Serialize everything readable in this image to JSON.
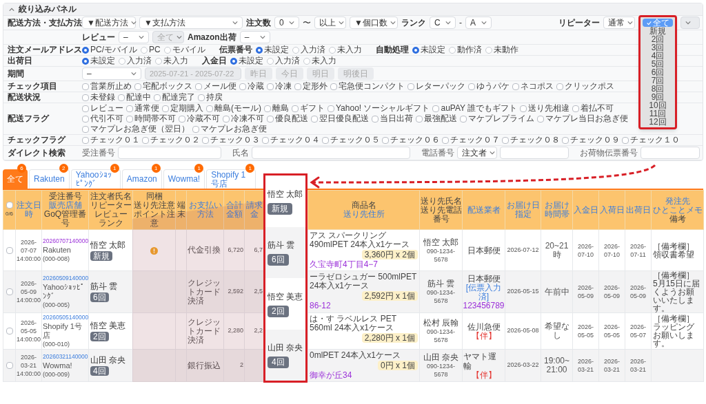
{
  "filter_panel": {
    "title": "絞り込みパネル",
    "expanded": true,
    "shipping_payment": {
      "label": "配送方法・支払方法",
      "shipping_method": "▼配送方法",
      "payment_method": "▼支払方法",
      "order_count_label": "注文数",
      "order_count_from": "0",
      "tilde": "〜",
      "order_count_to": "以上",
      "parcel_count": "▼個口数",
      "rank_label": "ランク",
      "rank_from": "C",
      "dash": "-",
      "rank_to": "A",
      "repeater_label": "リピーター",
      "repeater_mode": "通常",
      "repeater_options": [
        {
          "label": "全て",
          "selected": true
        },
        {
          "label": "新規",
          "selected": false
        },
        {
          "label": "2回",
          "selected": false
        },
        {
          "label": "3回",
          "selected": false
        },
        {
          "label": "4回",
          "selected": false
        },
        {
          "label": "5回",
          "selected": false
        },
        {
          "label": "6回",
          "selected": false
        },
        {
          "label": "7回",
          "selected": false
        },
        {
          "label": "8回",
          "selected": false
        },
        {
          "label": "9回",
          "selected": false
        },
        {
          "label": "10回",
          "selected": false
        },
        {
          "label": "11回",
          "selected": false
        },
        {
          "label": "12回",
          "selected": false
        }
      ],
      "repeater_count_disabled": true
    },
    "review_row": {
      "review_label": "レビュー",
      "review_value": "–",
      "review_scope": {
        "value": "全て",
        "disabled": true
      },
      "amazon_label": "Amazon出荷",
      "amazon_value": "–"
    },
    "radio_rows": [
      {
        "label": "注文メールアドレス",
        "groups": [
          {
            "options": [
              {
                "label": "PC/モバイル",
                "selected": true
              },
              {
                "label": "PC",
                "selected": false
              },
              {
                "label": "モバイル",
                "selected": false
              }
            ]
          },
          {
            "label": "伝票番号",
            "options": [
              {
                "label": "未設定",
                "selected": true
              },
              {
                "label": "入力済",
                "selected": false
              },
              {
                "label": "未入力",
                "selected": false
              }
            ]
          },
          {
            "label": "自動処理",
            "options": [
              {
                "label": "未設定",
                "selected": true
              },
              {
                "label": "動作済",
                "selected": false
              },
              {
                "label": "未動作",
                "selected": false
              }
            ]
          }
        ]
      },
      {
        "label": "出荷日",
        "groups": [
          {
            "options": [
              {
                "label": "未設定",
                "selected": true
              },
              {
                "label": "入力済",
                "selected": false
              },
              {
                "label": "未入力",
                "selected": false
              }
            ]
          },
          {
            "label": "入金日",
            "options": [
              {
                "label": "未設定",
                "selected": true
              },
              {
                "label": "入力済",
                "selected": false
              },
              {
                "label": "未入力",
                "selected": false
              }
            ]
          }
        ]
      }
    ],
    "period": {
      "label": "期間",
      "value": "–",
      "date_range": "2025-07-21 - 2025-07-22",
      "date_range_disabled": true,
      "quick_buttons": [
        {
          "label": "昨日",
          "disabled": true
        },
        {
          "label": "今日",
          "disabled": true
        },
        {
          "label": "明日",
          "disabled": true
        },
        {
          "label": "明後日",
          "disabled": true
        }
      ]
    },
    "check_rows": [
      {
        "label": "チェック項目",
        "items": [
          {
            "label": "営業所止め",
            "checked": false
          },
          {
            "label": "宅配ボックス",
            "checked": false
          },
          {
            "label": "メール便",
            "checked": false
          },
          {
            "label": "冷蔵",
            "checked": false
          },
          {
            "label": "冷凍",
            "checked": false
          },
          {
            "label": "定形外",
            "checked": false
          },
          {
            "label": "宅急便コンパクト",
            "checked": false
          },
          {
            "label": "レターパック",
            "checked": false
          },
          {
            "label": "ゆうパケ",
            "checked": false
          },
          {
            "label": "ネコポス",
            "checked": false
          },
          {
            "label": "クリックポス",
            "checked": false
          }
        ]
      },
      {
        "label": "配送状況",
        "items": [
          {
            "label": "未登録",
            "checked": false
          },
          {
            "label": "配達中",
            "checked": false
          },
          {
            "label": "配達完了",
            "checked": false
          },
          {
            "label": "持戻",
            "checked": false
          }
        ]
      },
      {
        "label": "配送フラグ",
        "items": [
          {
            "label": "レビュー",
            "checked": false
          },
          {
            "label": "通常便",
            "checked": false
          },
          {
            "label": "定期購入",
            "checked": false
          },
          {
            "label": "離島(モール)",
            "checked": false
          },
          {
            "label": "離島",
            "checked": false
          },
          {
            "label": "ギフト",
            "checked": false
          },
          {
            "label": "Yahoo! ソーシャルギフト",
            "checked": false
          },
          {
            "label": "auPAY 誰でもギフト",
            "checked": false
          },
          {
            "label": "送り先相違",
            "checked": false
          },
          {
            "label": "着払不可",
            "checked": false
          },
          {
            "label": "代引不可",
            "checked": false
          },
          {
            "label": "時間帯不可",
            "checked": false
          },
          {
            "label": "冷蔵不可",
            "checked": false
          },
          {
            "label": "冷凍不可",
            "checked": false
          },
          {
            "label": "優良配送",
            "checked": false
          },
          {
            "label": "翌日優良配送",
            "checked": false
          },
          {
            "label": "当日出荷",
            "checked": false
          },
          {
            "label": "最強配送",
            "checked": false
          },
          {
            "label": "マケプレプライム",
            "checked": false
          },
          {
            "label": "マケプレ当日お急ぎ便",
            "checked": false
          },
          {
            "label": "マケプレお急ぎ便（翌日）",
            "checked": false
          },
          {
            "label": "マケプレお急ぎ便",
            "checked": false
          }
        ]
      }
    ],
    "check_flags": {
      "label": "チェックフラグ",
      "items": [
        {
          "label": "チェック０１",
          "checked": false
        },
        {
          "label": "チェック０２",
          "checked": false
        },
        {
          "label": "チェック０３",
          "checked": false
        },
        {
          "label": "チェック０４",
          "checked": false
        },
        {
          "label": "チェック０５",
          "checked": false
        },
        {
          "label": "チェック０６",
          "checked": false
        },
        {
          "label": "チェック０７",
          "checked": false
        },
        {
          "label": "チェック０８",
          "checked": false
        },
        {
          "label": "チェック０９",
          "checked": false
        },
        {
          "label": "チェック１０",
          "checked": false
        }
      ]
    },
    "direct_search": {
      "label": "ダイレクト検索",
      "order_no_label": "受注番号",
      "name_label": "氏名",
      "phone_label": "電話番号",
      "phone_target": "注文者",
      "slip_label": "お荷物伝票番号"
    }
  },
  "order_tabs": [
    {
      "label": "全て",
      "count": "6",
      "selected": true
    },
    {
      "label": "Rakuten",
      "count": "2",
      "selected": false
    },
    {
      "label": "Yahooｼｮｯﾋﾟﾝｸﾞ",
      "count": "1",
      "selected": false
    },
    {
      "label": "Amazon",
      "count": "1",
      "selected": false
    },
    {
      "label": "Wowma!",
      "count": "1",
      "selected": false
    },
    {
      "label": "Shopify 1号店",
      "count": "1",
      "selected": false
    }
  ],
  "orders_table": {
    "select_all": {
      "checked": false
    },
    "selection_count": "0/6",
    "columns": [
      {
        "lines": [
          {
            "text": "注文日時",
            "link": true
          }
        ]
      },
      {
        "lines": [
          {
            "text": "受注番号",
            "link": false
          },
          {
            "text": "販売店舗",
            "link": true
          },
          {
            "text": "GoQ管理番号",
            "link": false
          }
        ]
      },
      {
        "lines": [
          {
            "text": "注文者氏名",
            "link": false
          },
          {
            "text": "リピーター",
            "link": false
          },
          {
            "text": "レビュー",
            "link": false
          },
          {
            "text": "ランク",
            "link": false
          }
        ]
      },
      {
        "lines": [
          {
            "text": "同梱",
            "link": false
          },
          {
            "text": "送り先注意",
            "link": false
          },
          {
            "text": "ポイント注意",
            "link": false
          }
        ]
      },
      {
        "lines": [
          {
            "text": "端末",
            "link": false
          }
        ]
      },
      {
        "lines": [
          {
            "text": "お支払い方法",
            "link": true
          }
        ]
      },
      {
        "lines": [
          {
            "text": "合計金額",
            "link": true
          }
        ]
      },
      {
        "lines": [
          {
            "text": "請求金",
            "link": true
          }
        ]
      },
      {
        "lines": [
          {
            "text": "商品名",
            "link": false
          },
          {
            "text": "送り先住所",
            "link": true
          }
        ]
      },
      {
        "lines": [
          {
            "text": "送り先氏名",
            "link": false
          },
          {
            "text": "送り先電話番号",
            "link": false
          }
        ]
      },
      {
        "lines": [
          {
            "text": "配送業者",
            "link": true
          }
        ]
      },
      {
        "lines": [
          {
            "text": "お届け日指定",
            "link": true
          }
        ]
      },
      {
        "lines": [
          {
            "text": "お届け時間帯",
            "link": true
          }
        ]
      },
      {
        "lines": [
          {
            "text": "入金日",
            "link": true
          }
        ]
      },
      {
        "lines": [
          {
            "text": "入荷日",
            "link": true
          }
        ]
      },
      {
        "lines": [
          {
            "text": "出荷日",
            "link": true
          }
        ]
      },
      {
        "lines": [
          {
            "text": "発注先",
            "link": true
          },
          {
            "text": "ひとことメモ",
            "link": true
          },
          {
            "text": "備考",
            "link": false
          }
        ]
      }
    ],
    "rows": [
      {
        "checked": false,
        "order_date": "2026-07-07 14:00:00",
        "order_no": "20260707140000",
        "visited": true,
        "store": "Rakuten",
        "goq_no": "(000-008)",
        "customer": "悟空 太郎",
        "repeater": "新規",
        "attention": true,
        "payment": "代金引換",
        "total": "6,720",
        "billed": "6,7",
        "product": "アス スパークリング 490mlPET 24本入x1ケース",
        "price": "3,360円 x 2個",
        "address": "久宝寺町4丁目4−7",
        "recipient": "悟空 太郎",
        "phone": "090-1234-5678",
        "carrier": "日本郵便",
        "delivery_date": "2026-07-12",
        "delivery_time": "20~21時",
        "paid": "2026-07-10",
        "arrived": "2026-07-10",
        "shipped": "2026-07-11",
        "memo_title": "［備考欄］",
        "memo": "領収書希望"
      },
      {
        "checked": false,
        "order_date": "2026-05-09 14:00:00",
        "order_no": "20260509140000",
        "visited": false,
        "store": "Yahooｼｮｯﾋﾟﾝｸﾞ",
        "goq_no": "(000-005)",
        "customer": "筋斗 雲",
        "repeater": "6回",
        "attention": false,
        "payment": "クレジットカード決済",
        "total": "2,592",
        "billed": "2,5",
        "product": "ーラゼロシュガー 500mlPET 24本入x1ケース",
        "price": "2,592円 x 1個",
        "address": "86-12",
        "recipient": "筋斗 雲",
        "phone": "090-1234-5678",
        "carrier": "日本郵便",
        "carrier_links": [
          {
            "text": "[伝票入力済]",
            "color": "#3b7ddd"
          },
          {
            "text": "123456789",
            "color": "#9b30d9"
          }
        ],
        "delivery_date": "2026-05-15",
        "delivery_time": "午前中",
        "paid": "2026-05-09",
        "arrived": "2026-05-09",
        "shipped": "2026-05-09",
        "memo_title": "［備考欄］",
        "memo": "5月15日に届くようお願いいたします。"
      },
      {
        "checked": false,
        "order_date": "2026-05-05 14:00:00",
        "order_no": "20260505140000",
        "visited": false,
        "store": "Shopify 1号店",
        "goq_no": "(000-010)",
        "customer": "悟空 美恵",
        "repeater": "2回",
        "attention": false,
        "payment": "クレジットカード決済",
        "total": "2,280",
        "billed": "2,2",
        "product": "は・す ラベルレス PET 560ml 24本入x1ケース",
        "price": "2,280円 x 1個",
        "recipient": "松村 辰翰",
        "phone": "090-1234-5678",
        "carrier": "佐川急便",
        "carrier_links": [
          {
            "text": "【伴】",
            "color": "#e53935"
          }
        ],
        "delivery_date": "2026-05-08",
        "delivery_time": "希望なし",
        "paid": "2026-05-05",
        "arrived": "2026-05-05",
        "shipped": "2026-05-07",
        "memo_title": "［備考欄］",
        "memo": "ラッピングお願いします。"
      },
      {
        "checked": false,
        "order_date": "2026-03-21 14:00:00",
        "order_no": "20260321140000",
        "visited": false,
        "store": "Wowma!",
        "goq_no": "(000-009)",
        "customer": "山田 奈央",
        "repeater": "4回",
        "attention": false,
        "payment": "銀行振込",
        "total": "2",
        "product": "0mlPET 24本入x1ケース",
        "price": "0円 x 1個",
        "address": "御幸が丘34",
        "recipient": "山田 奈央",
        "phone": "090-1234-5678",
        "carrier": "ヤマト運輸",
        "carrier_links": [
          {
            "text": "【伴】",
            "color": "#e53935"
          }
        ],
        "delivery_date": "2026-03-22",
        "delivery_time": "19:00~21:00",
        "paid": "2026-03-21",
        "arrived": "2026-03-21",
        "shipped": "2026-03-21"
      }
    ]
  },
  "callout": {
    "entries": [
      {
        "name": "悟空 太郎",
        "repeater": "新規"
      },
      {
        "name": "筋斗 雲",
        "repeater": "6回"
      },
      {
        "name": "悟空 美恵",
        "repeater": "2回"
      },
      {
        "name": "山田 奈央",
        "repeater": "4回"
      }
    ]
  }
}
